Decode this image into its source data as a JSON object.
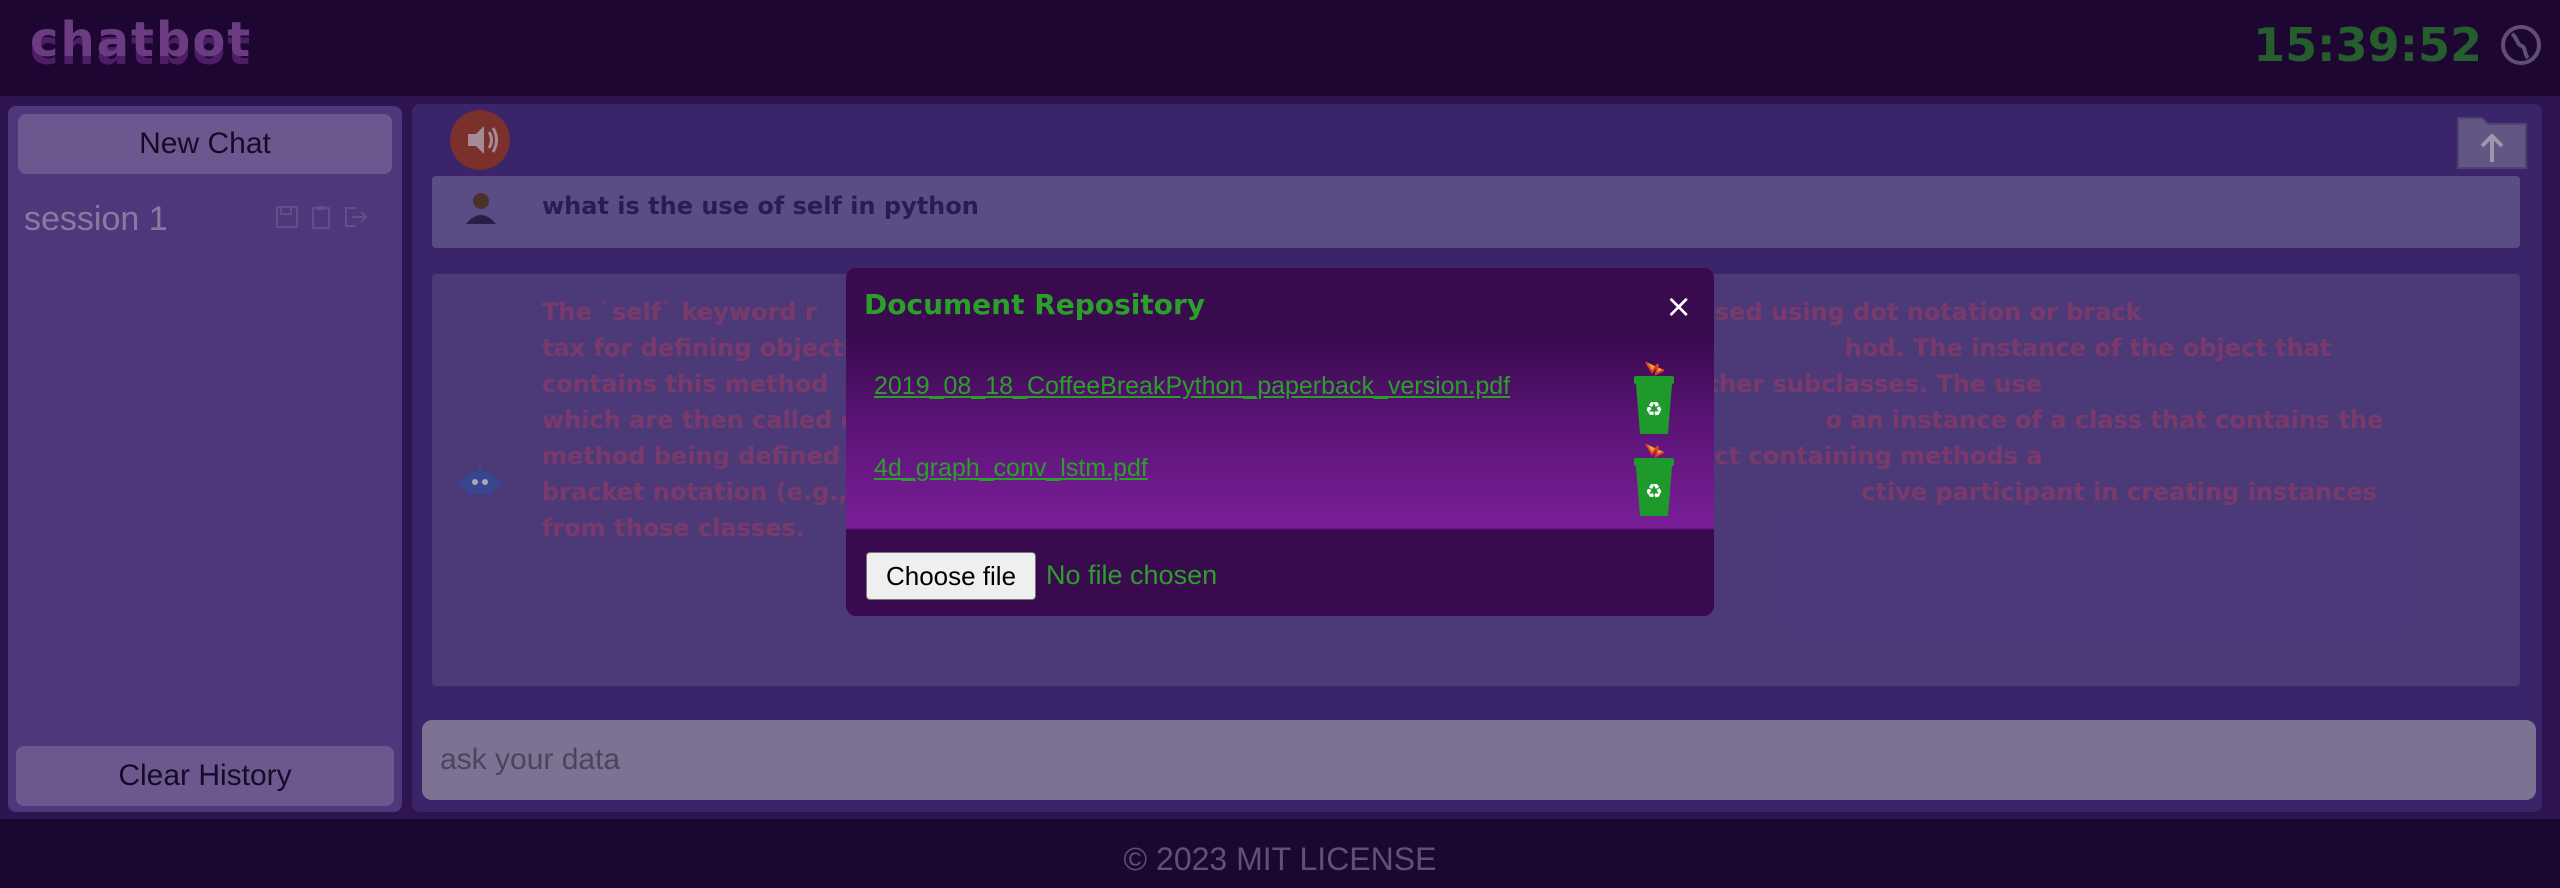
{
  "header": {
    "logo": "chatbot",
    "clock": "15:39:52",
    "globe_icon": "globe-icon"
  },
  "sidebar": {
    "new_chat_label": "New Chat",
    "sessions": [
      {
        "label": "session 1",
        "icons": [
          "save-icon",
          "clipboard-icon",
          "logout-icon"
        ]
      }
    ],
    "clear_history_label": "Clear History"
  },
  "chat": {
    "speaker_icon": "speaker-icon",
    "upload_icon": "upload-folder-icon",
    "user_message": "what is the use of self in python",
    "bot_message": "The `self` keyword r                                                       d attributes, which can be accessed using dot notation or brack                                                      tax for defining objects, a new method is defined on each subc                                                      hod. The instance of the object that contains this method                                                      nd using instances of itself or other subclasses. The use                                                       which are then called on objects created from those classes (                                                      o an instance of a class that contains the method being defined                                                      ummary: self refers to the object containing methods a                                                      bracket notation (e.g., obj.method()). The use of self is seen wh                                                      ctive participant in creating instances from those classes.",
    "input_placeholder": "ask your data"
  },
  "modal": {
    "title": "Document Repository",
    "close_label": "×",
    "documents": [
      {
        "name": "2019_08_18_CoffeeBreakPython_paperback_version.pdf",
        "icon": "recycle-bin-icon"
      },
      {
        "name": "4d_graph_conv_lstm.pdf",
        "icon": "recycle-bin-icon"
      }
    ],
    "choose_file_label": "Choose file",
    "file_status": "No file chosen"
  },
  "footer": {
    "text": "© 2023 MIT LICENSE"
  },
  "colors": {
    "accent_green": "#2aa02a",
    "background": "#1f0b33",
    "panel": "#513a8e"
  }
}
